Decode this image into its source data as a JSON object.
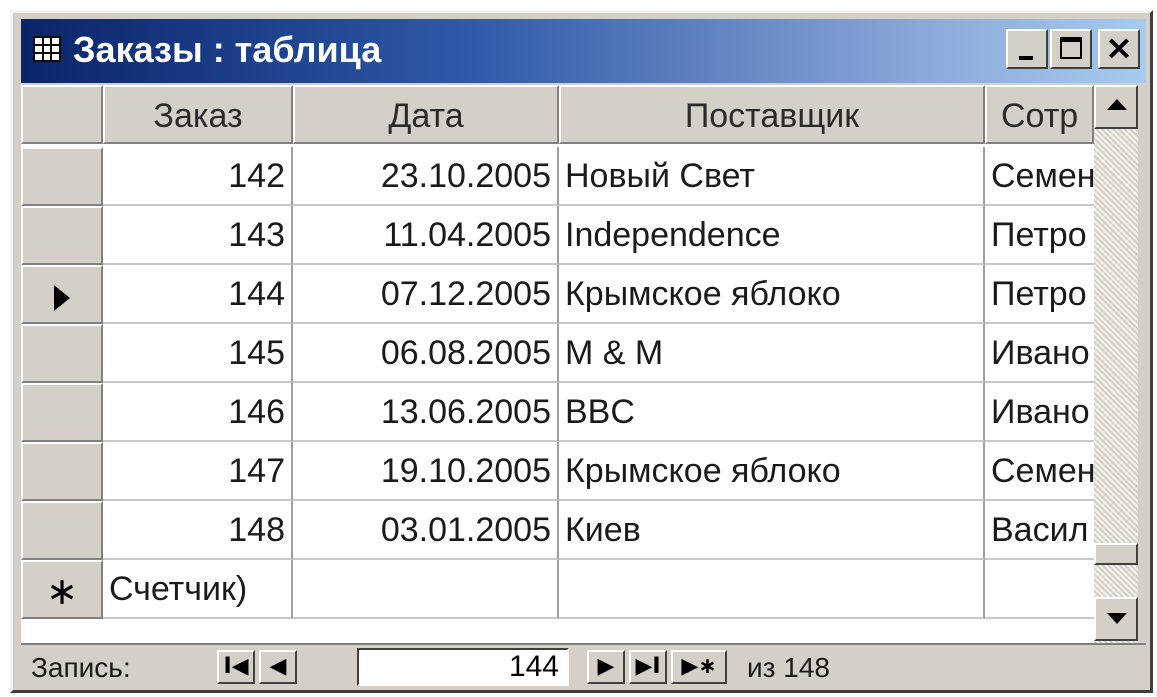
{
  "window": {
    "title": "Заказы : таблица",
    "close_glyph": "×"
  },
  "table": {
    "columns": [
      "Заказ",
      "Дата",
      "Поставщик",
      "Сотр"
    ],
    "rows": [
      {
        "order": "142",
        "date": "23.10.2005",
        "supplier": "Новый Свет",
        "employee": "Семен"
      },
      {
        "order": "143",
        "date": "11.04.2005",
        "supplier": "Independence",
        "employee": "Петро"
      },
      {
        "order": "144",
        "date": "07.12.2005",
        "supplier": "Крымское яблоко",
        "employee": "Петро"
      },
      {
        "order": "145",
        "date": "06.08.2005",
        "supplier": "M & M",
        "employee": "Ивано"
      },
      {
        "order": "146",
        "date": "13.06.2005",
        "supplier": "BBC",
        "employee": "Ивано"
      },
      {
        "order": "147",
        "date": "19.10.2005",
        "supplier": "Крымское яблоко",
        "employee": "Семен"
      },
      {
        "order": "148",
        "date": "03.01.2005",
        "supplier": "Киев",
        "employee": "Васил"
      }
    ],
    "current_row_index": 2,
    "new_row": {
      "marker": "∗",
      "order": "Счетчик)"
    }
  },
  "navigation": {
    "label": "Запись:",
    "current": "144",
    "total_text": "из 148",
    "first_glyph": "I◀",
    "prev_glyph": "◀",
    "next_glyph": "▶",
    "last_glyph": "▶I",
    "new_glyph": "▶∗"
  },
  "icons": {
    "window_icon": "table-icon",
    "minimize": "minimize-icon",
    "maximize": "maximize-icon",
    "close": "close-icon",
    "scroll_up": "scroll-up-icon",
    "scroll_down": "scroll-down-icon",
    "row_pointer": "current-record-icon",
    "new_record": "new-record-icon"
  },
  "colors": {
    "title_gradient_start": "#0a246a",
    "title_gradient_end": "#a6caf0",
    "chrome": "#d4d0c8"
  }
}
